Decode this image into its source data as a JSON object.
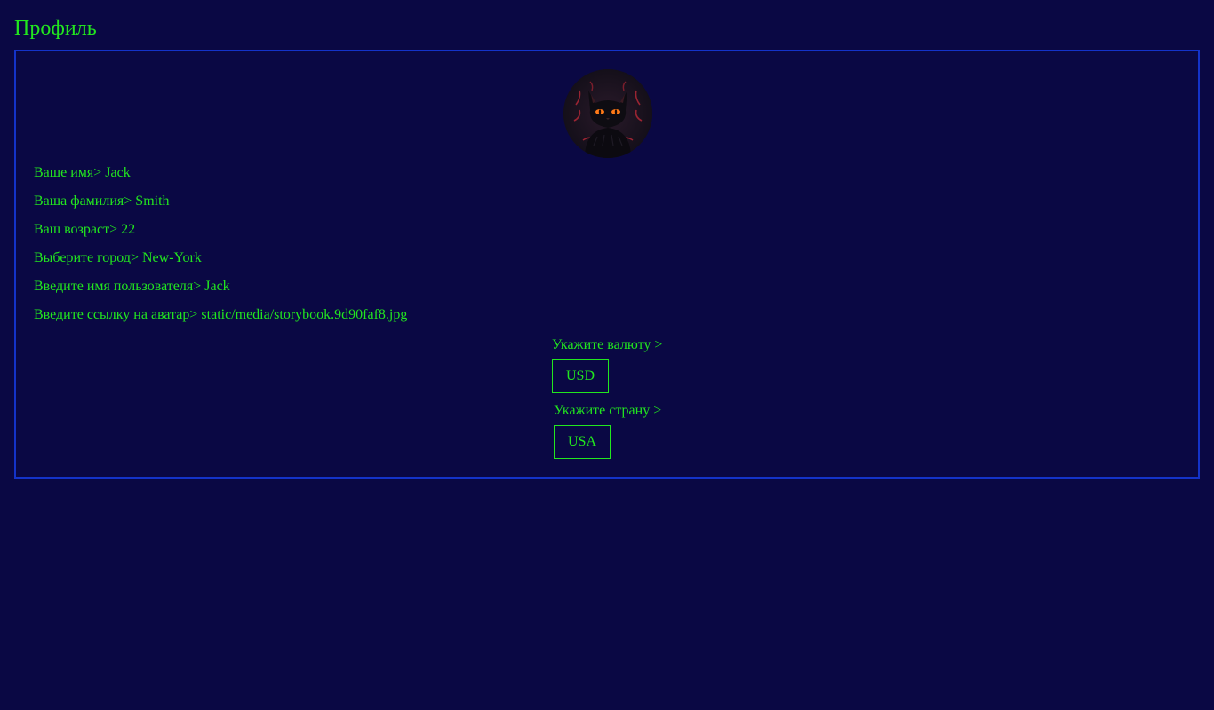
{
  "page": {
    "title": "Профиль"
  },
  "profile": {
    "fields": [
      {
        "label": "Ваше имя",
        "value": "Jack"
      },
      {
        "label": "Ваша фамилия",
        "value": "Smith"
      },
      {
        "label": "Ваш возраст",
        "value": "22"
      },
      {
        "label": "Выберите город",
        "value": "New-York"
      },
      {
        "label": "Введите имя пользователя",
        "value": "Jack"
      },
      {
        "label": "Введите ссылку на аватар",
        "value": "static/media/storybook.9d90faf8.jpg"
      }
    ],
    "currency": {
      "label": "Укажите валюту >",
      "value": "USD"
    },
    "country": {
      "label": "Укажите страну >",
      "value": "USA"
    }
  },
  "colors": {
    "background": "#0a0844",
    "text": "#22e61f",
    "card_border": "#1433c9"
  },
  "icons": {
    "avatar": "black-cat-avatar"
  }
}
